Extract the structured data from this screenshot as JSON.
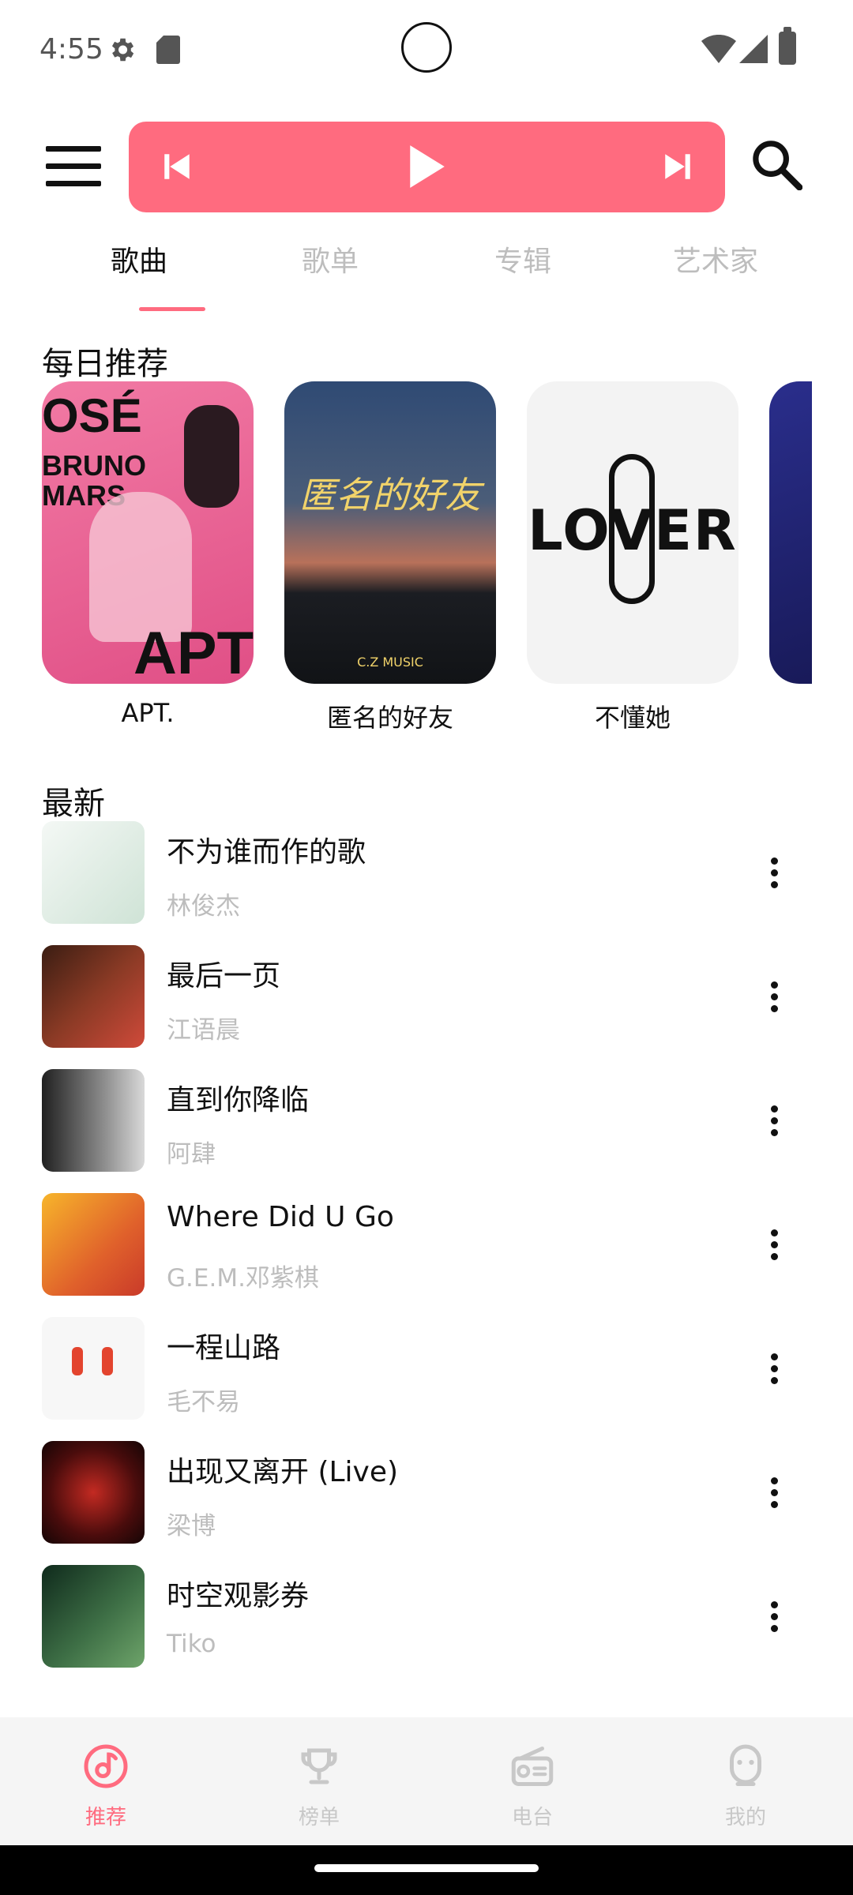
{
  "status_bar": {
    "time": "4:55"
  },
  "player": {
    "prev_icon": "skip-previous-icon",
    "play_icon": "play-icon",
    "next_icon": "skip-next-icon"
  },
  "tabs": [
    {
      "label": "歌曲",
      "active": true
    },
    {
      "label": "歌单",
      "active": false
    },
    {
      "label": "专辑",
      "active": false
    },
    {
      "label": "艺术家",
      "active": false
    }
  ],
  "daily": {
    "title": "每日推荐",
    "items": [
      {
        "name": "APT.",
        "cover_colors": [
          "#f06c99",
          "#e85588"
        ],
        "cover_text": "OSÉ BRUNO MARS APT"
      },
      {
        "name": "匿名的好友",
        "cover_colors": [
          "#33466b",
          "#121418"
        ],
        "cover_text": "匿名的好友"
      },
      {
        "name": "不懂她",
        "cover_colors": [
          "#f3f3f3",
          "#e7e7e7"
        ],
        "cover_text": "LOVER"
      },
      {
        "name": "",
        "cover_colors": [
          "#1d1f6b",
          "#3a2f91"
        ],
        "cover_text": ""
      }
    ]
  },
  "latest": {
    "title": "最新",
    "songs": [
      {
        "title": "不为谁而作的歌",
        "artist": "林俊杰",
        "thumb_colors": [
          "#eaf3ee",
          "#cfe3d8"
        ]
      },
      {
        "title": "最后一页",
        "artist": "江语晨",
        "thumb_colors": [
          "#3a1d12",
          "#c74b3a"
        ]
      },
      {
        "title": "直到你降临",
        "artist": "阿肆",
        "thumb_colors": [
          "#2b2b2b",
          "#a9a9a9"
        ]
      },
      {
        "title": "Where Did U Go",
        "artist": "G.E.M.邓紫棋",
        "thumb_colors": [
          "#f4a21b",
          "#d8442a"
        ]
      },
      {
        "title": "一程山路",
        "artist": "毛不易",
        "thumb_colors": [
          "#f7f7f7",
          "#eeeeee"
        ]
      },
      {
        "title": "出现又离开 (Live)",
        "artist": "梁博",
        "thumb_colors": [
          "#1a0a0a",
          "#b22020"
        ]
      },
      {
        "title": "时空观影券",
        "artist": "Tiko",
        "thumb_colors": [
          "#0f2e1e",
          "#4f8a58"
        ]
      }
    ]
  },
  "bottom_nav": [
    {
      "label": "推荐",
      "icon": "music-note-icon",
      "active": true
    },
    {
      "label": "榜单",
      "icon": "trophy-icon",
      "active": false
    },
    {
      "label": "电台",
      "icon": "radio-icon",
      "active": false
    },
    {
      "label": "我的",
      "icon": "person-icon",
      "active": false
    }
  ],
  "colors": {
    "accent": "#ff6b7f",
    "muted": "#bdbdbd"
  }
}
